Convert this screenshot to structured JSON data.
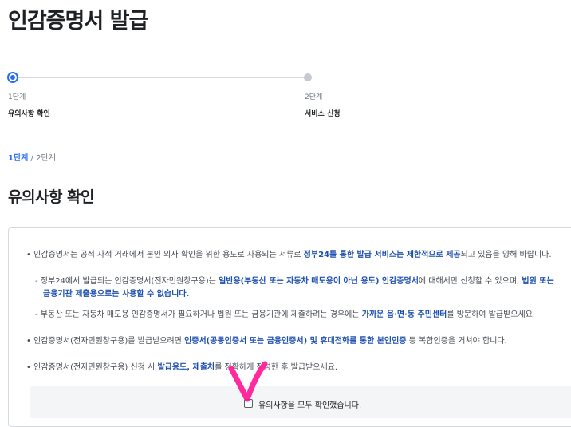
{
  "page": {
    "title": "인감증명서 발급"
  },
  "stepper": {
    "steps": [
      {
        "num": "1단계",
        "name": "유의사항 확인",
        "state": "active"
      },
      {
        "num": "2단계",
        "name": "서비스 신청",
        "state": "inactive"
      }
    ]
  },
  "breadcrumb": {
    "current": "1단계",
    "separator": " / ",
    "total": "2단계"
  },
  "section": {
    "title": "유의사항 확인"
  },
  "notice": {
    "line1": {
      "bullet": "•",
      "t1": "인감증명서는 공적·사적 거래에서 본인 의사 확인을 위한 용도로 사용되는 서류로 ",
      "h1": "정부24를 통한 발급 서비스는 제한적으로 제공",
      "t2": "되고 있음을 양해 바랍니다."
    },
    "line2": {
      "dash": "-",
      "t1": "정부24에서 발급되는 인감증명서(전자민원창구용)는 ",
      "h1": "일반용(부동산 또는 자동차 매도용이 아닌 용도) 인감증명서",
      "t2": "에 대해서만 신청할 수 있으며, ",
      "h2": "법원 또는"
    },
    "line2b": {
      "h1": "금융기관 제출용으로는 사용할 수 없습니다."
    },
    "line3": {
      "dash": "-",
      "t1": "부동산 또는 자동차 매도용 인감증명서가 필요하거나 법원 또는 금융기관에 제출하려는 경우에는 ",
      "h1": "가까운 읍·면·동 주민센터",
      "t2": "를 방문하여 발급받으세요."
    },
    "line4": {
      "bullet": "•",
      "t1": "인감증명서(전자민원창구용)를 발급받으려면 ",
      "h1": "인증서(공동인증서 또는 금융인증서) 및 휴대전화를 통한 본인인증",
      "t2": " 등 복합인증을 거쳐야 합니다."
    },
    "line5": {
      "bullet": "•",
      "t1": "인감증명서(전자민원창구용) 신청 시 ",
      "h1": "발급용도, 제출처",
      "t2": "를 정확하게 작성한 후 발급받으세요."
    }
  },
  "confirm": {
    "label": "유의사항을 모두 확인했습니다.",
    "checked": false
  },
  "colors": {
    "accent": "#256ef4",
    "highlight": "#1d4fae",
    "annotation": "#ff1493"
  }
}
